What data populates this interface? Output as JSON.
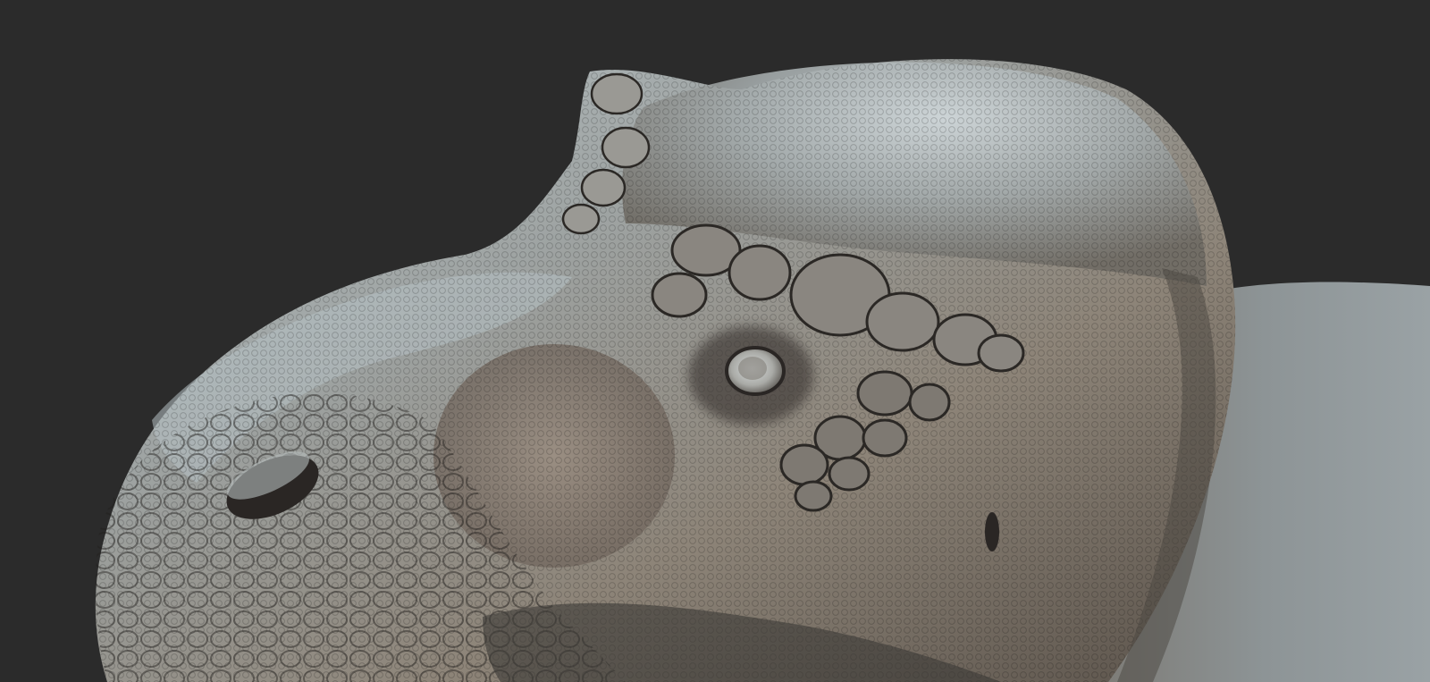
{
  "scene": {
    "subject": "dinosaur-head-sculpt",
    "background_color": "#2b2b2b",
    "palette": {
      "skin_highlight": "#c9d2d6",
      "skin_mid": "#8c8f8c",
      "skin_warm": "#9a8877",
      "skin_shadow": "#3b3835",
      "skin_deep": "#1f1d1c"
    }
  }
}
